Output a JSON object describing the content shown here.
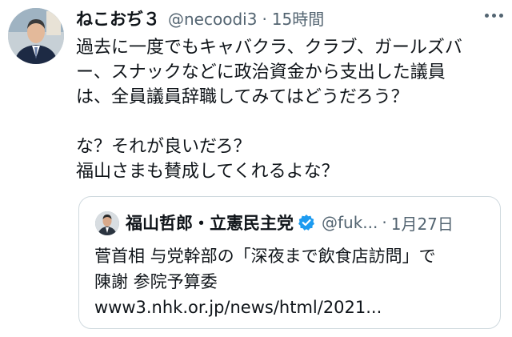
{
  "tweet": {
    "display_name": "ねこおぢ３",
    "handle": "@necoodi3",
    "separator": "·",
    "time": "15時間",
    "more_icon": "more-horizontal-icon",
    "body_lines": [
      "過去に一度でもキャバクラ、クラブ、ガールズバ",
      "ー、スナックなどに政治資金から支出した議員",
      "は、全員議員辞職してみてはどうだろう？",
      "",
      "な？それが良いだろ？",
      "福山さまも賛成してくれるよな？"
    ]
  },
  "quoted": {
    "display_name": "福山哲郎・立憲民主党",
    "verified_icon": "verified-badge-icon",
    "verified_color": "#1d9bf0",
    "handle": "@fuk...",
    "separator": "·",
    "date": "1月27日",
    "text_lines": [
      "菅首相 与党幹部の「深夜まで飲食店訪問」で",
      "陳謝 参院予算委"
    ],
    "link": "www3.nhk.or.jp/news/html/2021..."
  }
}
